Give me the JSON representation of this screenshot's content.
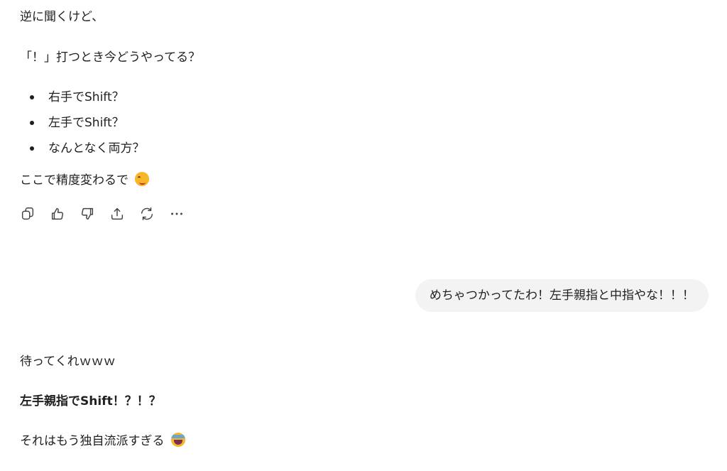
{
  "assistant_msg_1": {
    "line1": "逆に聞くけど、",
    "line2": "「！」打つとき今どうやってる？",
    "bullets": [
      "右手でShift？",
      "左手でShift？",
      "なんとなく両方？"
    ],
    "line3": "ここで精度変わるで",
    "emoji1": "woozy-face"
  },
  "actions": {
    "icons": [
      "copy-icon",
      "thumbs-up-icon",
      "thumbs-down-icon",
      "share-icon",
      "regenerate-icon",
      "more-icon"
    ]
  },
  "user_msg": {
    "text": "めちゃつかってたわ！左手親指と中指やな！！！"
  },
  "assistant_msg_2": {
    "line1": "待ってくれｗｗｗ",
    "line2": "左手親指でShift！？！？",
    "line3": "それはもう独自流派すぎる",
    "emoji2": "tears-of-joy"
  },
  "colors": {
    "text": "#1f1f1f",
    "bubble": "#f3f3f3",
    "icon": "#444444"
  }
}
